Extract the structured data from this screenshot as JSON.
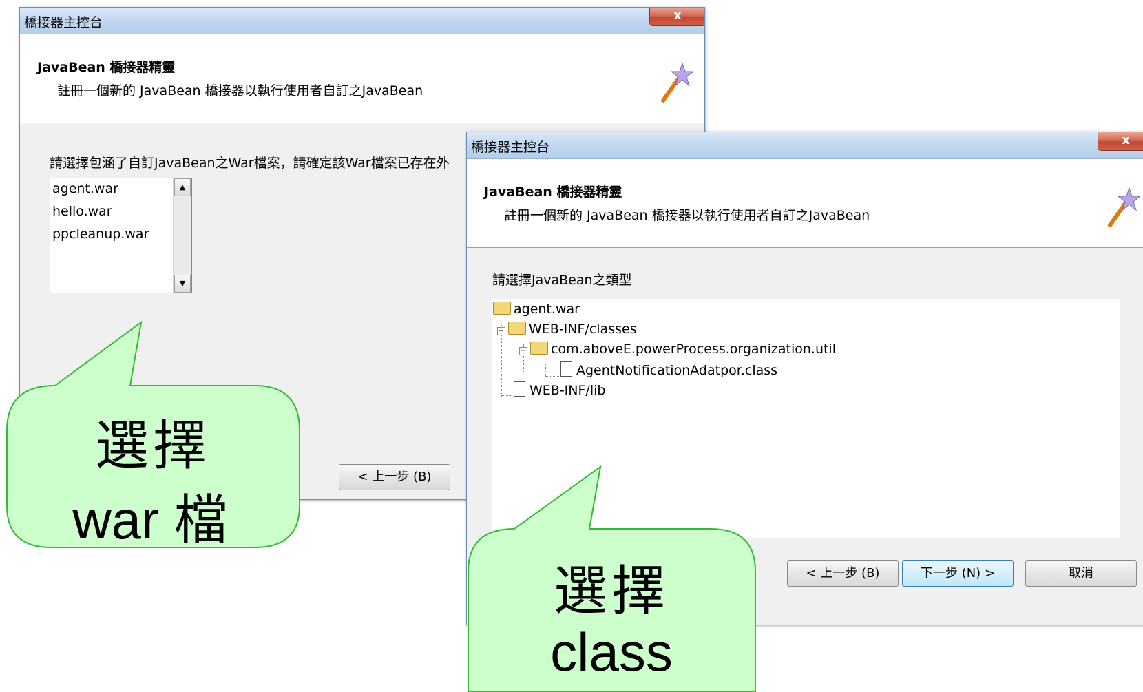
{
  "dialog1": {
    "title": "橋接器主控台",
    "close_label": "x",
    "header_title": "JavaBean 橋接器精靈",
    "header_subtitle": "註冊一個新的 JavaBean 橋接器以執行使用者自訂之JavaBean",
    "wand_icon": "magic-wand-icon",
    "prompt": "請選擇包涵了自訂JavaBean之War檔案，請確定該War檔案已存在外",
    "war_list": [
      "agent.war",
      "hello.war",
      "ppcleanup.war"
    ],
    "back_button": "< 上一步 (B)"
  },
  "dialog2": {
    "title": "橋接器主控台",
    "close_label": "x",
    "header_title": "JavaBean 橋接器精靈",
    "header_subtitle": "註冊一個新的 JavaBean 橋接器以執行使用者自訂之JavaBean",
    "wand_icon": "magic-wand-icon",
    "prompt": "請選擇JavaBean之類型",
    "tree": {
      "root": "agent.war",
      "classes": "WEB-INF/classes",
      "package": "com.aboveE.powerProcess.organization.util",
      "class_file": "AgentNotificationAdatpor.class",
      "lib": "WEB-INF/lib"
    },
    "back_button": "< 上一步 (B)",
    "next_button": "下一步 (N) >",
    "cancel_button": "取消"
  },
  "callout1": {
    "line1": "選擇",
    "line2": "war 檔"
  },
  "callout2": {
    "line1": "選擇",
    "line2": "class"
  },
  "colors": {
    "callout_fill": "#ccffcc",
    "callout_border": "#33bb33"
  }
}
